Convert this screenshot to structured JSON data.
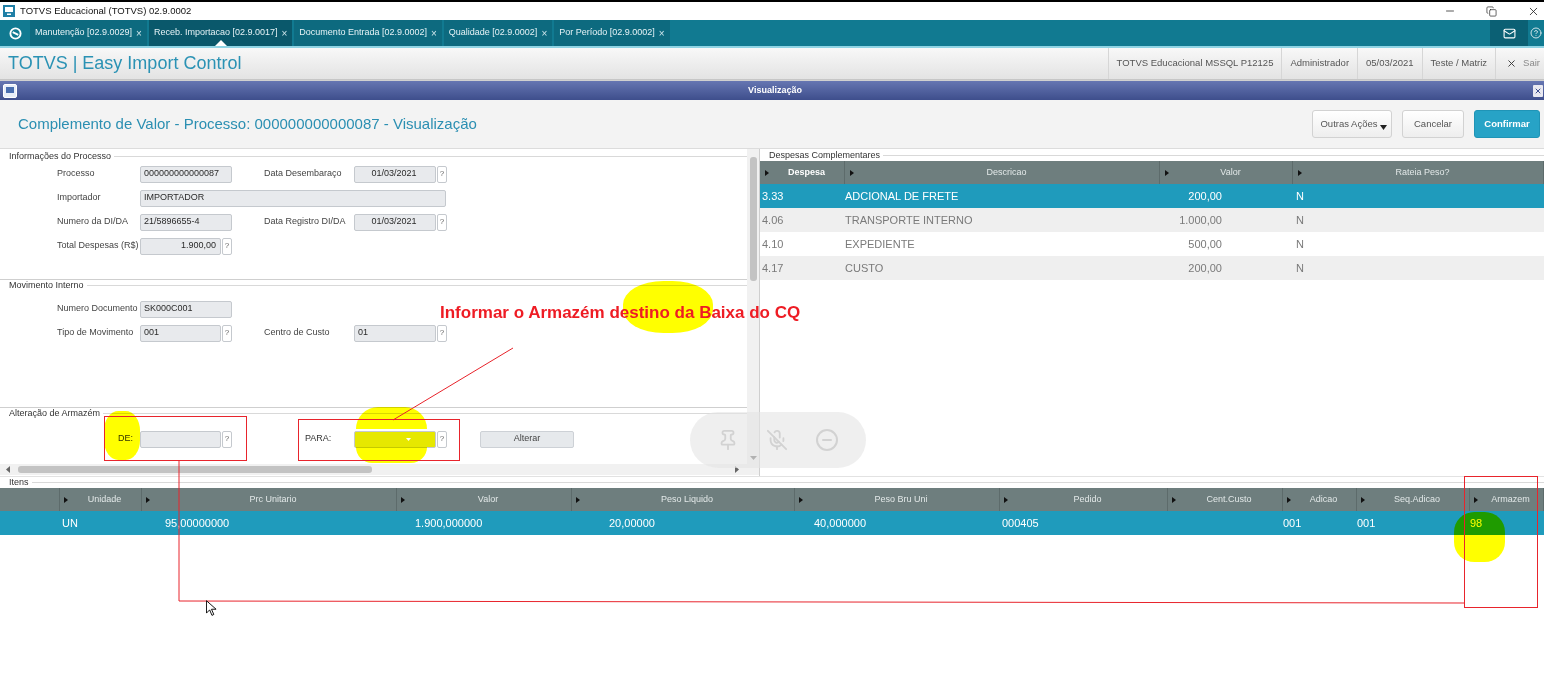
{
  "window": {
    "title": "TOTVS Educacional (TOTVS) 02.9.0002"
  },
  "tabs": [
    {
      "label": "Manutenção [02.9.0029]",
      "close": "×",
      "selected": false
    },
    {
      "label": "Receb. Importacao [02.9.0017]",
      "close": "×",
      "selected": true
    },
    {
      "label": "Documento Entrada [02.9.0002]",
      "close": "×",
      "selected": false
    },
    {
      "label": "Qualidade [02.9.0002]",
      "close": "×",
      "selected": false
    },
    {
      "label": "Por Período [02.9.0002]",
      "close": "×",
      "selected": false
    }
  ],
  "app_header": {
    "title": "TOTVS | Easy Import Control",
    "info": [
      "TOTVS Educacional MSSQL P12125",
      "Administrador",
      "05/03/2021",
      "Teste / Matriz"
    ],
    "exit": {
      "label": "Sair",
      "disabled": true
    }
  },
  "dialog": {
    "title": "Visualização",
    "heading": "Complemento de Valor - Processo: 000000000000087 - Visualização",
    "buttons": [
      {
        "label": "Outras Ações",
        "kind": "menu"
      },
      {
        "label": "Cancelar",
        "kind": "secondary"
      },
      {
        "label": "Confirmar",
        "kind": "primary"
      }
    ]
  },
  "process_info": {
    "title": "Informações do Processo",
    "rows": [
      [
        {
          "label": "Processo",
          "value": "000000000000087"
        },
        {
          "label": "Data Desembaraço",
          "value": "01/03/2021",
          "kind": "date",
          "help": "?"
        }
      ],
      [
        {
          "label": "Importador",
          "value": "IMPORTADOR",
          "kind": "wide"
        }
      ],
      [
        {
          "label": "Numero da DI/DA",
          "value": "21/5896655-4"
        },
        {
          "label": "Data Registro DI/DA",
          "value": "01/03/2021",
          "kind": "date",
          "help": "?"
        }
      ],
      [
        {
          "label": "Total Despesas (R$)",
          "value": "1.900,00",
          "kind": "number",
          "help": "?"
        }
      ]
    ]
  },
  "internal_movement": {
    "title": "Movimento Interno",
    "rows": [
      [
        {
          "label": "Numero Documento",
          "value": "SK000C001"
        }
      ],
      [
        {
          "label": "Tipo de Movimento",
          "value": "001",
          "help": "?"
        },
        {
          "label": "Centro de Custo",
          "value": "01",
          "help": "?"
        }
      ]
    ]
  },
  "warehouse_change": {
    "title": "Alteração de Armazém",
    "from": {
      "label": "DE:",
      "help": "?",
      "highlighted": false
    },
    "to": {
      "label": "PARA:",
      "help": "?",
      "highlighted": true
    },
    "button": "Alterar"
  },
  "expenses": {
    "title": "Despesas Complementares",
    "columns": [
      {
        "label": "Despesa",
        "active": true
      },
      {
        "label": "Descricao",
        "active": false
      },
      {
        "label": "Valor",
        "active": false
      },
      {
        "label": "Rateia Peso?",
        "active": false
      }
    ],
    "rows": [
      {
        "selected": true,
        "cells": [
          "3.33",
          "ADCIONAL DE FRETE",
          "200,00",
          "N"
        ]
      },
      {
        "selected": false,
        "cells": [
          "4.06",
          "TRANSPORTE INTERNO",
          "1.000,00",
          "N"
        ]
      },
      {
        "selected": false,
        "cells": [
          "4.10",
          "EXPEDIENTE",
          "500,00",
          "N"
        ]
      },
      {
        "selected": false,
        "cells": [
          "4.17",
          "CUSTO",
          "200,00",
          "N"
        ]
      }
    ]
  },
  "items": {
    "title": "Itens",
    "columns": [
      "Unidade",
      "Prc Unitario",
      "Valor",
      "Peso Liquido",
      "Peso Bru Uni",
      "Pedido",
      "Cent.Custo",
      "Adicao",
      "Seq.Adicao",
      "Armazem"
    ],
    "rows": [
      {
        "selected": true,
        "cells": [
          "UN",
          "95,00000000",
          "1.900,000000",
          "20,00000",
          "40,000000",
          "000405",
          null,
          "001",
          "001",
          "98"
        ]
      }
    ]
  },
  "annotation": {
    "text": "Informar o Armazém destino da Baixa do CQ"
  }
}
